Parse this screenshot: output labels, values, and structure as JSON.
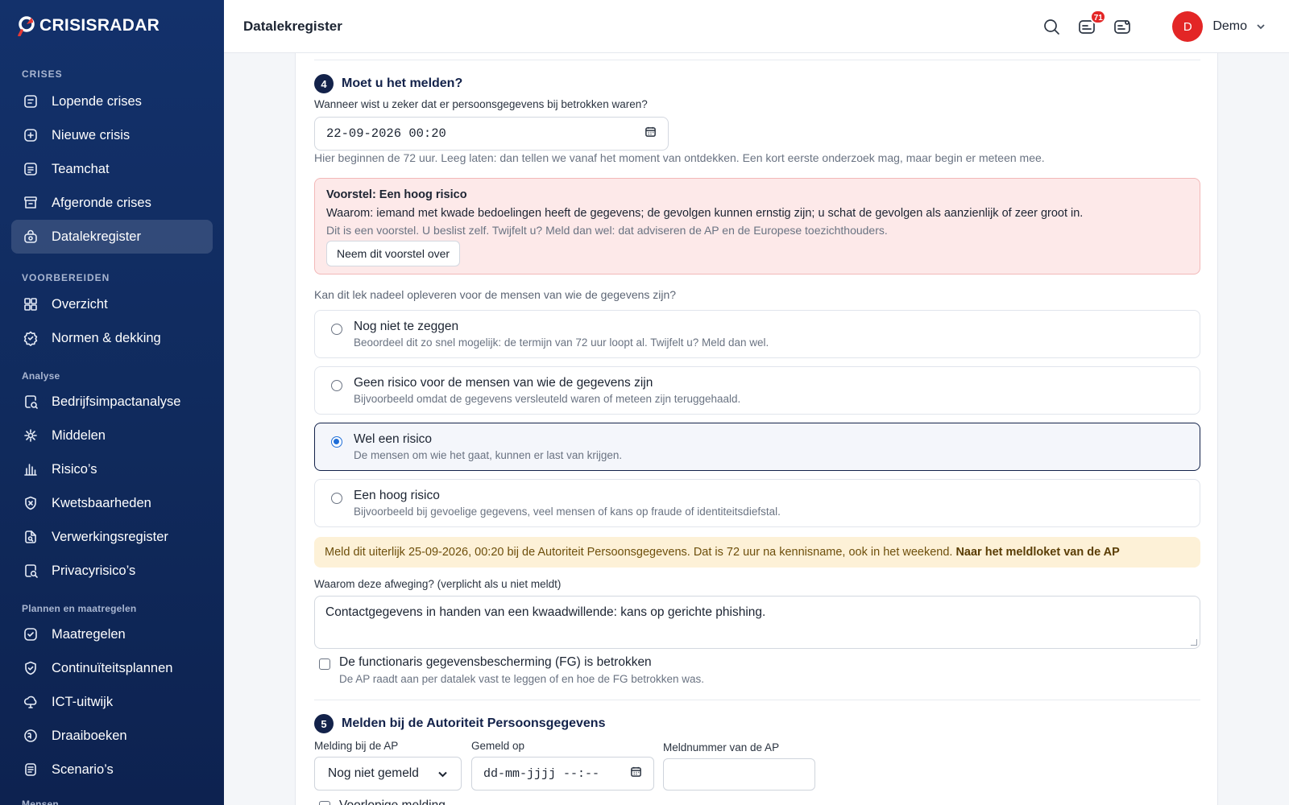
{
  "app": {
    "logo_text": "CRISISRADAR"
  },
  "sidebar": {
    "sections": [
      {
        "title": "CRISES",
        "items": [
          {
            "label": "Lopende crises",
            "icon": "list-icon"
          },
          {
            "label": "Nieuwe crisis",
            "icon": "plus-square-icon"
          },
          {
            "label": "Teamchat",
            "icon": "chat-icon"
          },
          {
            "label": "Afgeronde crises",
            "icon": "archive-icon"
          },
          {
            "label": "Datalekregister",
            "icon": "lock-icon",
            "active": true
          }
        ]
      },
      {
        "title": "VOORBEREIDEN",
        "items": [
          {
            "label": "Overzicht",
            "icon": "grid-icon"
          },
          {
            "label": "Normen & dekking",
            "icon": "shield-check-icon"
          }
        ]
      },
      {
        "title": "Analyse",
        "items": [
          {
            "label": "Bedrijfsimpactanalyse",
            "icon": "analysis-icon"
          },
          {
            "label": "Middelen",
            "icon": "resources-icon"
          },
          {
            "label": "Risico’s",
            "icon": "bar-chart-icon"
          },
          {
            "label": "Kwetsbaarheden",
            "icon": "shield-x-icon"
          },
          {
            "label": "Verwerkingsregister",
            "icon": "doc-search-icon"
          },
          {
            "label": "Privacyrisico’s",
            "icon": "privacy-search-icon"
          }
        ]
      },
      {
        "title": "Plannen en maatregelen",
        "items": [
          {
            "label": "Maatregelen",
            "icon": "check-square-icon"
          },
          {
            "label": "Continuïteitsplannen",
            "icon": "shield-icon"
          },
          {
            "label": "ICT-uitwijk",
            "icon": "cloud-icon"
          },
          {
            "label": "Draaiboeken",
            "icon": "book-icon"
          },
          {
            "label": "Scenario’s",
            "icon": "scenario-icon"
          }
        ]
      },
      {
        "title": "Mensen",
        "items": []
      }
    ]
  },
  "topbar": {
    "title": "Datalekregister",
    "notification_count": "71",
    "user_initial": "D",
    "user_name": "Demo"
  },
  "step4": {
    "number": "4",
    "title": "Moet u het melden?",
    "known_label": "Wanneer wist u zeker dat er persoonsgegevens bij betrokken waren?",
    "known_value": "22-09-2026 00:20",
    "known_hint": "Hier beginnen de 72 uur. Leeg laten: dan tellen we vanaf het moment van ontdekken. Een kort eerste onderzoek mag, maar begin er meteen mee.",
    "suggestion": {
      "title": "Voorstel: Een hoog risico",
      "why": "Waarom: iemand met kwade bedoelingen heeft de gegevens; de gevolgen kunnen ernstig zijn; u schat de gevolgen als aanzienlijk of zeer groot in.",
      "note": "Dit is een voorstel. U beslist zelf. Twijfelt u? Meld dan wel: dat adviseren de AP en de Europese toezichthouders.",
      "button": "Neem dit voorstel over"
    },
    "risk_question": "Kan dit lek nadeel opleveren voor de mensen van wie de gegevens zijn?",
    "options": [
      {
        "title": "Nog niet te zeggen",
        "sub": "Beoordeel dit zo snel mogelijk: de termijn van 72 uur loopt al. Twijfelt u? Meld dan wel.",
        "selected": false
      },
      {
        "title": "Geen risico voor de mensen van wie de gegevens zijn",
        "sub": "Bijvoorbeeld omdat de gegevens versleuteld waren of meteen zijn teruggehaald.",
        "selected": false
      },
      {
        "title": "Wel een risico",
        "sub": "De mensen om wie het gaat, kunnen er last van krijgen.",
        "selected": true
      },
      {
        "title": "Een hoog risico",
        "sub": "Bijvoorbeeld bij gevoelige gegevens, veel mensen of kans op fraude of identiteitsdiefstal.",
        "selected": false
      }
    ],
    "deadline_text": "Meld dit uiterlijk 25-09-2026, 00:20 bij de Autoriteit Persoonsgegevens. Dat is 72 uur na kennisname, ook in het weekend.",
    "deadline_link": "Naar het meldloket van de AP",
    "reason_label": "Waarom deze afweging? (verplicht als u niet meldt)",
    "reason_value": "Contactgegevens in handen van een kwaadwillende: kans op gerichte phishing.",
    "fg_label": "De functionaris gegevensbescherming (FG) is betrokken",
    "fg_hint": "De AP raadt aan per datalek vast te leggen of en hoe de FG betrokken was."
  },
  "step5": {
    "number": "5",
    "title": "Melden bij de Autoriteit Persoonsgegevens",
    "melding_label": "Melding bij de AP",
    "melding_value": "Nog niet gemeld",
    "gemeld_label": "Gemeld op",
    "gemeld_placeholder": "dd-mm-jjjj --:--",
    "meldnummer_label": "Meldnummer van de AP",
    "meldnummer_value": "",
    "provisional_label": "Voorlopige melding"
  }
}
